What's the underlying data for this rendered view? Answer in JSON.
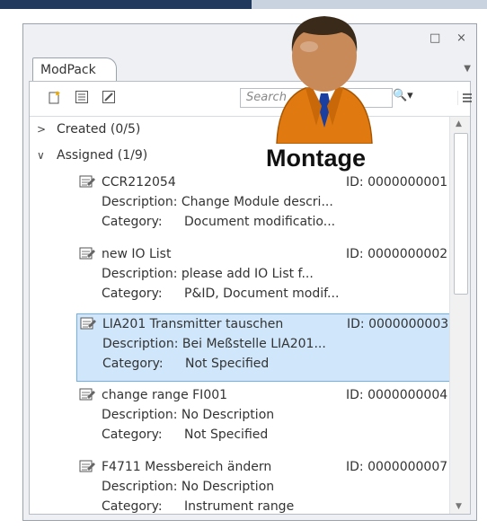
{
  "window": {
    "restore_glyph": "□",
    "close_glyph": "×",
    "tab_label": "ModPack",
    "menu_arrow_glyph": "▼"
  },
  "toolbar": {
    "search_placeholder": "Search",
    "binoculars_glyph": "🔍▾"
  },
  "tree": {
    "groups": [
      {
        "label": "Created (0/5)",
        "chevron": ">"
      },
      {
        "label": "Assigned (1/9)",
        "chevron": "∨"
      }
    ],
    "items": [
      {
        "title": "CCR212054",
        "id": "ID: 0000000001",
        "description_label": "Description:",
        "description": "Change Module descri...",
        "category_label": "Category:",
        "category": "Document modificatio..."
      },
      {
        "title": "new IO List",
        "id": "ID: 0000000002",
        "description_label": "Description:",
        "description": "please add IO List f...",
        "category_label": "Category:",
        "category": "P&ID, Document modif..."
      },
      {
        "title": "LIA201 Transmitter tauschen",
        "id": "ID: 0000000003",
        "description_label": "Description:",
        "description": "Bei Meßstelle LIA201...",
        "category_label": "Category:",
        "category": "Not Specified",
        "selected": true
      },
      {
        "title": "change range FI001",
        "id": "ID: 0000000004",
        "description_label": "Description:",
        "description": "No Description",
        "category_label": "Category:",
        "category": "Not Specified"
      },
      {
        "title": "F4711 Messbereich ändern",
        "id": "ID: 0000000007",
        "description_label": "Description:",
        "description": "No Description",
        "category_label": "Category:",
        "category": "Instrument range"
      }
    ]
  },
  "overlay": {
    "caption": "Montage",
    "colors": {
      "suit": "#e07a10",
      "tie": "#1a3fa0",
      "skin": "#c98a5a",
      "hair": "#3a2a1a"
    }
  }
}
